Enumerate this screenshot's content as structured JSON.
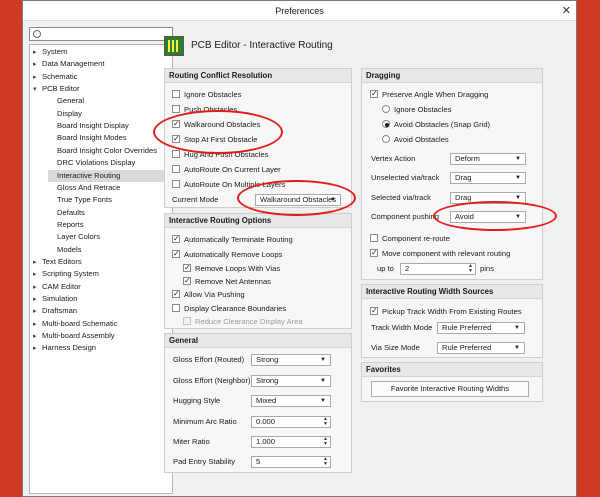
{
  "window": {
    "title": "Preferences"
  },
  "search": {
    "value": ""
  },
  "tree": [
    {
      "label": "System",
      "arrow": "▸",
      "indent": 0
    },
    {
      "label": "Data Management",
      "arrow": "▸",
      "indent": 0
    },
    {
      "label": "Schematic",
      "arrow": "▸",
      "indent": 0
    },
    {
      "label": "PCB Editor",
      "arrow": "▾",
      "indent": 0
    },
    {
      "label": "General",
      "arrow": "",
      "indent": 1
    },
    {
      "label": "Display",
      "arrow": "",
      "indent": 1
    },
    {
      "label": "Board Insight Display",
      "arrow": "",
      "indent": 1
    },
    {
      "label": "Board Insight Modes",
      "arrow": "",
      "indent": 1
    },
    {
      "label": "Board Insight Color Overrides",
      "arrow": "",
      "indent": 1
    },
    {
      "label": "DRC Violations Display",
      "arrow": "",
      "indent": 1
    },
    {
      "label": "Interactive Routing",
      "arrow": "",
      "indent": 1,
      "selected": true
    },
    {
      "label": "Gloss And Retrace",
      "arrow": "",
      "indent": 1
    },
    {
      "label": "True Type Fonts",
      "arrow": "",
      "indent": 1
    },
    {
      "label": "Defaults",
      "arrow": "",
      "indent": 1
    },
    {
      "label": "Reports",
      "arrow": "",
      "indent": 1
    },
    {
      "label": "Layer Colors",
      "arrow": "",
      "indent": 1
    },
    {
      "label": "Models",
      "arrow": "",
      "indent": 1
    },
    {
      "label": "Text Editors",
      "arrow": "▸",
      "indent": 0
    },
    {
      "label": "Scripting System",
      "arrow": "▸",
      "indent": 0
    },
    {
      "label": "CAM Editor",
      "arrow": "▸",
      "indent": 0
    },
    {
      "label": "Simulation",
      "arrow": "▸",
      "indent": 0
    },
    {
      "label": "Draftsman",
      "arrow": "▸",
      "indent": 0
    },
    {
      "label": "Multi-board Schematic",
      "arrow": "▸",
      "indent": 0
    },
    {
      "label": "Multi-board Assembly",
      "arrow": "▸",
      "indent": 0
    },
    {
      "label": "Harness Design",
      "arrow": "▸",
      "indent": 0
    }
  ],
  "header": {
    "title": "PCB Editor - Interactive Routing",
    "icon": "pcb-board-icon"
  },
  "conflict": {
    "title": "Routing Conflict Resolution",
    "ignore": "Ignore Obstacles",
    "push": "Push Obstacles",
    "walkaround": "Walkaround Obstacles",
    "stop": "Stop At First Obstacle",
    "hug": "Hug And Push Obstacles",
    "auto_current": "AutoRoute On Current Layer",
    "auto_multi": "AutoRoute On Multiple Layers",
    "mode_label": "Current Mode",
    "mode_value": "Walkaround Obstacles"
  },
  "options": {
    "title": "Interactive Routing Options",
    "auto_terminate": "Automatically Terminate Routing",
    "auto_remove": "Automatically Remove Loops",
    "remove_vias": "Remove Loops With Vias",
    "remove_antennas": "Remove Net Antennas",
    "allow_via": "Allow Via Pushing",
    "display_clear": "Display Clearance Boundaries",
    "reduce_clear": "Reduce Clearance Display Area"
  },
  "general": {
    "title": "General",
    "gloss_routed_label": "Gloss Effort (Routed)",
    "gloss_routed": "Strong",
    "gloss_neighbor_label": "Gloss Effort (Neighbor)",
    "gloss_neighbor": "Strong",
    "hugging_label": "Hugging Style",
    "hugging": "Mixed",
    "min_arc_label": "Minimum Arc Ratio",
    "min_arc": "0.000",
    "miter_label": "Miter Ratio",
    "miter": "1.000",
    "pad_entry_label": "Pad Entry Stability",
    "pad_entry": "5"
  },
  "dragging": {
    "title": "Dragging",
    "preserve": "Preserve Angle When Dragging",
    "ignore": "Ignore Obstacles",
    "avoid_snap": "Avoid Obstacles (Snap Grid)",
    "avoid": "Avoid Obstacles",
    "vertex_label": "Vertex Action",
    "vertex": "Deform",
    "unsel_label": "Unselected via/track",
    "unsel": "Drag",
    "sel_label": "Selected via/track",
    "sel": "Drag",
    "pushing_label": "Component pushing",
    "pushing": "Avoid",
    "reroute": "Component re-route",
    "move_comp": "Move component with relevant routing",
    "upto_label": "up to",
    "upto": "2",
    "pins": "pins"
  },
  "widths": {
    "title": "Interactive Routing Width Sources",
    "pickup": "Pickup Track Width From Existing Routes",
    "track_label": "Track Width Mode",
    "track": "Rule Preferred",
    "via_label": "Via Size Mode",
    "via": "Rule Preferred"
  },
  "favorites": {
    "title": "Favorites",
    "button": "Favorite Interactive Routing Widths"
  },
  "colors": {
    "annotation": "#e21b1b",
    "pcb_background": "#d6402b"
  }
}
